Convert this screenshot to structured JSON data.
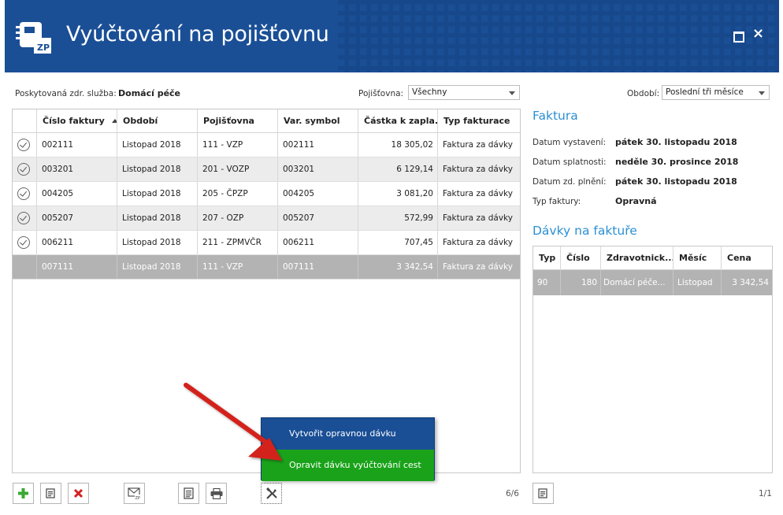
{
  "window": {
    "title": "Vyúčtování na pojišťovnu",
    "logo_text": "ZP",
    "close_glyph": "×"
  },
  "filters": {
    "service_label": "Poskytovaná zdr. služba:",
    "service_value": "Domácí péče",
    "insurer_label": "Pojišťovna:",
    "insurer_value": "Všechny",
    "period_label": "Období:",
    "period_value": "Poslední tři měsíce"
  },
  "invoices": {
    "columns": [
      "Číslo faktury",
      "Období",
      "Pojišťovna",
      "Var. symbol",
      "Částka k zapla...",
      "Typ fakturace"
    ],
    "rows": [
      {
        "checked": true,
        "number": "002111",
        "period": "Listopad 2018",
        "insurer": "111 - VZP",
        "var_symbol": "002111",
        "amount": "18 305,02",
        "type": "Faktura za dávky"
      },
      {
        "checked": true,
        "number": "003201",
        "period": "Listopad 2018",
        "insurer": "201 - VOZP",
        "var_symbol": "003201",
        "amount": "6 129,14",
        "type": "Faktura za dávky"
      },
      {
        "checked": true,
        "number": "004205",
        "period": "Listopad 2018",
        "insurer": "205 - ČPZP",
        "var_symbol": "004205",
        "amount": "3 081,20",
        "type": "Faktura za dávky"
      },
      {
        "checked": true,
        "number": "005207",
        "period": "Listopad 2018",
        "insurer": "207 - OZP",
        "var_symbol": "005207",
        "amount": "572,99",
        "type": "Faktura za dávky"
      },
      {
        "checked": true,
        "number": "006211",
        "period": "Listopad 2018",
        "insurer": "211 - ZPMVČR",
        "var_symbol": "006211",
        "amount": "707,45",
        "type": "Faktura za dávky"
      },
      {
        "checked": false,
        "selected": true,
        "number": "007111",
        "period": "Listopad 2018",
        "insurer": "111 - VZP",
        "var_symbol": "007111",
        "amount": "3 342,54",
        "type": "Faktura za dávky"
      }
    ],
    "pager": "6/6"
  },
  "invoice_detail": {
    "title": "Faktura",
    "issued_label": "Datum vystavení:",
    "issued_value": "pátek 30. listopadu 2018",
    "due_label": "Datum splatnosti:",
    "due_value": "neděle 30. prosince 2018",
    "taxable_label": "Datum zd. plnění:",
    "taxable_value": "pátek 30. listopadu 2018",
    "type_label": "Typ faktury:",
    "type_value": "Opravná"
  },
  "batches": {
    "title": "Dávky na faktuře",
    "columns": [
      "Typ",
      "Číslo",
      "Zdravotnick...",
      "Měsíc",
      "Cena"
    ],
    "rows": [
      {
        "type": "90",
        "number": "180",
        "facility": "Domácí péče...",
        "month": "Listopad",
        "price": "3 342,54"
      }
    ],
    "pager": "1/1"
  },
  "context_menu": {
    "items": [
      "Vytvořit opravnou dávku",
      "Opravit dávku vyúčtování cest"
    ],
    "highlighted": 1
  },
  "toolbar": {
    "icons": [
      "add-icon",
      "edit-icon",
      "delete-icon",
      "send-zp-icon",
      "document-icon",
      "print-icon",
      "tools-icon"
    ]
  },
  "colors": {
    "header": "#1a4f96",
    "accent_blue": "#2b8fd3",
    "highlight_green": "#1aa31a",
    "selection_gray": "#b3b3b3",
    "add_green": "#3aa832",
    "delete_red": "#d42020"
  }
}
